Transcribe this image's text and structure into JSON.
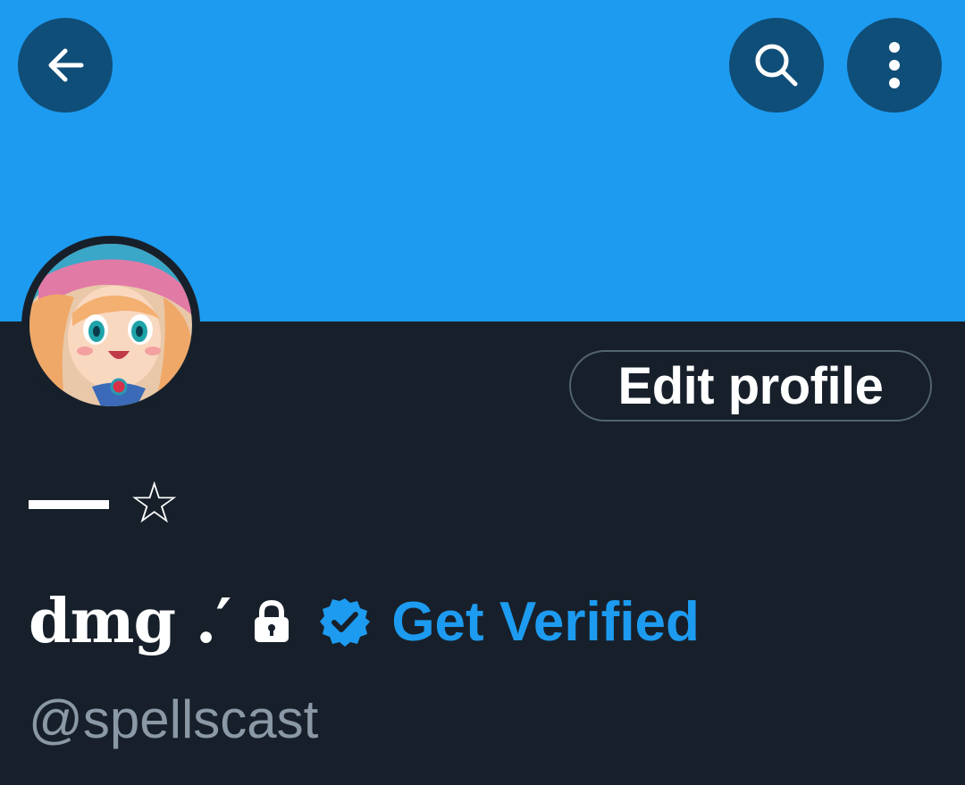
{
  "header": {
    "back_icon": "arrow-left-icon",
    "search_icon": "search-icon",
    "more_icon": "more-vertical-icon",
    "banner_color": "#1d9bf0",
    "button_bg_color": "#0f4e78"
  },
  "profile": {
    "avatar_icon": "anime-avatar",
    "edit_button_label": "Edit profile",
    "display_line": "☆",
    "name": "dmg .′",
    "lock_icon": "lock-icon",
    "verified_icon": "verified-badge-icon",
    "get_verified_label": "Get Verified",
    "handle": "@spellscast",
    "accent_color": "#1d9bf0",
    "background_color": "#17202a"
  }
}
